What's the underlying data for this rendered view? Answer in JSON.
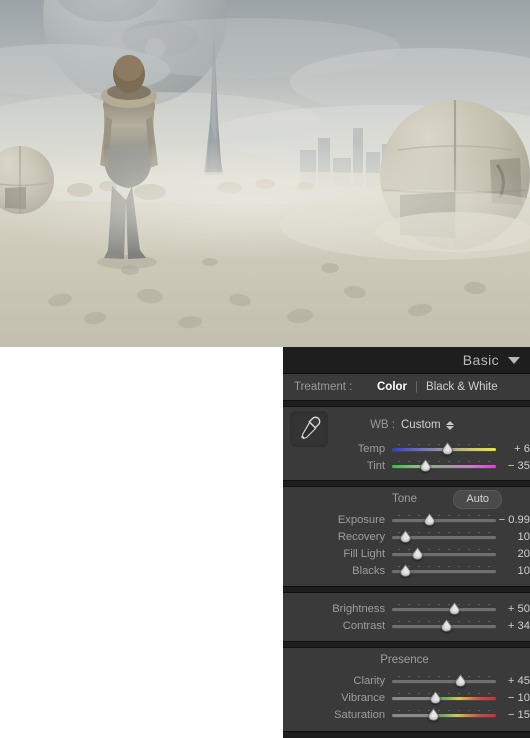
{
  "photo": {
    "alt_description": "Desert landscape with figure facing away, large planet in hazy sky, tall spire tower, spherical pod structures and distant city skyline",
    "sky_top": "#aab0b2",
    "sky_bottom": "#e6e6df",
    "sand": "#cdcabb"
  },
  "panel": {
    "title": "Basic",
    "collapse_icon": "chevron-down-icon",
    "treatment": {
      "label": "Treatment :",
      "options": [
        "Color",
        "Black & White"
      ],
      "selected": "Color",
      "separator": "|"
    },
    "white_balance": {
      "eyedropper_icon": "eyedropper-icon",
      "label": "WB :",
      "value": "Custom",
      "stepper_icon": "stepper-updown-icon",
      "sliders": [
        {
          "name": "Temp",
          "value": "+ 6",
          "pos": 55,
          "gradient": "temp"
        },
        {
          "name": "Tint",
          "value": "− 35",
          "pos": 33,
          "gradient": "tint"
        }
      ]
    },
    "tone": {
      "title": "Tone",
      "auto_label": "Auto",
      "sliders": [
        {
          "name": "Exposure",
          "value": "− 0.99",
          "pos": 37,
          "gradient": "plain"
        },
        {
          "name": "Recovery",
          "value": "10",
          "pos": 13,
          "gradient": "plain"
        },
        {
          "name": "Fill Light",
          "value": "20",
          "pos": 25,
          "gradient": "plain"
        },
        {
          "name": "Blacks",
          "value": "10",
          "pos": 13,
          "gradient": "plain"
        }
      ]
    },
    "brightness": {
      "sliders": [
        {
          "name": "Brightness",
          "value": "+ 50",
          "pos": 62,
          "gradient": "plain"
        },
        {
          "name": "Contrast",
          "value": "+ 34",
          "pos": 54,
          "gradient": "plain"
        }
      ]
    },
    "presence": {
      "title": "Presence",
      "sliders": [
        {
          "name": "Clarity",
          "value": "+ 45",
          "pos": 68,
          "gradient": "plain"
        },
        {
          "name": "Vibrance",
          "value": "− 10",
          "pos": 43,
          "gradient": "vibrance"
        },
        {
          "name": "Saturation",
          "value": "− 15",
          "pos": 41,
          "gradient": "saturation"
        }
      ]
    }
  }
}
